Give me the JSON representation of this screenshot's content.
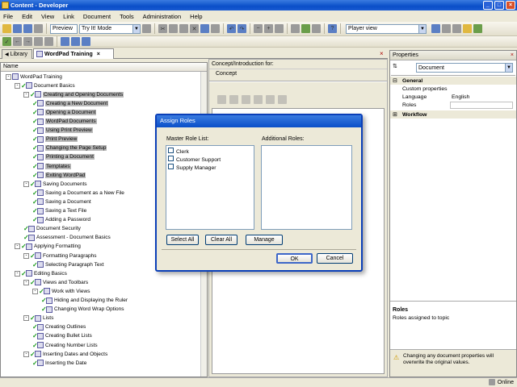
{
  "window": {
    "title": "Content - Developer",
    "min": "_",
    "max": "□",
    "close": "×"
  },
  "menu": [
    "File",
    "Edit",
    "View",
    "Link",
    "Document",
    "Tools",
    "Administration",
    "Help"
  ],
  "toolbar": {
    "preview": "Preview",
    "tryit": "Try It! Mode",
    "player": "Player view"
  },
  "tabs": {
    "library": "Library",
    "active": "WordPad Training",
    "close": "×"
  },
  "tree": {
    "header": "Name",
    "nodes": [
      {
        "d": 0,
        "t": "WordPad Training",
        "exp": "-",
        "chk": false,
        "sel": false
      },
      {
        "d": 1,
        "t": "Document Basics",
        "exp": "-",
        "chk": true,
        "sel": false
      },
      {
        "d": 2,
        "t": "Creating and Opening Documents",
        "exp": "-",
        "chk": true,
        "sel": true
      },
      {
        "d": 3,
        "t": "Creating a New Document",
        "chk": true,
        "sel": true
      },
      {
        "d": 3,
        "t": "Opening a Document",
        "chk": true,
        "sel": true
      },
      {
        "d": 3,
        "t": "WordPad Documents",
        "chk": true,
        "sel": true
      },
      {
        "d": 3,
        "t": "Using Print Preview",
        "chk": true,
        "sel": true
      },
      {
        "d": 3,
        "t": "Print Preview",
        "chk": true,
        "sel": true
      },
      {
        "d": 3,
        "t": "Changing the Page Setup",
        "chk": true,
        "sel": true
      },
      {
        "d": 3,
        "t": "Printing a Document",
        "chk": true,
        "sel": true
      },
      {
        "d": 3,
        "t": "Templates",
        "chk": true,
        "sel": true
      },
      {
        "d": 3,
        "t": "Exiting WordPad",
        "chk": true,
        "sel": true
      },
      {
        "d": 2,
        "t": "Saving Documents",
        "exp": "-",
        "chk": true,
        "sel": false
      },
      {
        "d": 3,
        "t": "Saving a Document as a New File",
        "chk": true,
        "sel": false
      },
      {
        "d": 3,
        "t": "Saving a Document",
        "chk": true,
        "sel": false
      },
      {
        "d": 3,
        "t": "Saving a Text File",
        "chk": true,
        "sel": false
      },
      {
        "d": 3,
        "t": "Adding a Password",
        "chk": true,
        "sel": false
      },
      {
        "d": 2,
        "t": "Document Security",
        "chk": true,
        "sel": false
      },
      {
        "d": 2,
        "t": "Assessment - Document Basics",
        "chk": true,
        "sel": false
      },
      {
        "d": 1,
        "t": "Applying Formatting",
        "exp": "-",
        "chk": true,
        "sel": false
      },
      {
        "d": 2,
        "t": "Formatting Paragraphs",
        "exp": "-",
        "chk": true,
        "sel": false
      },
      {
        "d": 3,
        "t": "Selecting Paragraph Text",
        "chk": true,
        "sel": false
      },
      {
        "d": 1,
        "t": "Editing Basics",
        "exp": "-",
        "chk": true,
        "sel": false
      },
      {
        "d": 2,
        "t": "Views and Toolbars",
        "exp": "-",
        "chk": true,
        "sel": false
      },
      {
        "d": 3,
        "t": "Work with Views",
        "exp": "-",
        "chk": true,
        "sel": false
      },
      {
        "d": 4,
        "t": "Hiding and Displaying the Ruler",
        "chk": true,
        "sel": false
      },
      {
        "d": 4,
        "t": "Changing Word Wrap Options",
        "chk": true,
        "sel": false
      },
      {
        "d": 2,
        "t": "Lists",
        "exp": "-",
        "chk": true,
        "sel": false
      },
      {
        "d": 3,
        "t": "Creating Outlines",
        "chk": true,
        "sel": false
      },
      {
        "d": 3,
        "t": "Creating Bullet Lists",
        "chk": true,
        "sel": false
      },
      {
        "d": 3,
        "t": "Creating Number Lists",
        "chk": true,
        "sel": false
      },
      {
        "d": 2,
        "t": "Inserting Dates and Objects",
        "exp": "-",
        "chk": true,
        "sel": false
      },
      {
        "d": 3,
        "t": "Inserting the Date",
        "chk": true,
        "sel": false
      }
    ]
  },
  "center": {
    "header": "Concept/Introduction for:",
    "concept_tab": "Concept"
  },
  "properties": {
    "title": "Properties",
    "combo": "Document",
    "general": "General",
    "custom": "Custom properties",
    "language_k": "Language",
    "language_v": "English",
    "roles_k": "Roles",
    "workflow": "Workflow",
    "roles_title": "Roles",
    "roles_desc": "Roles assigned to topic",
    "warning": "Changing any document properties will overwrite the original values."
  },
  "dialog": {
    "title": "Assign Roles",
    "master_label": "Master Role List:",
    "additional_label": "Additional Roles:",
    "roles": [
      "Clerk",
      "Customer Support",
      "Supply Manager"
    ],
    "select_all": "Select All",
    "clear_all": "Clear All",
    "manage": "Manage",
    "ok": "OK",
    "cancel": "Cancel"
  },
  "status": {
    "online": "Online"
  }
}
